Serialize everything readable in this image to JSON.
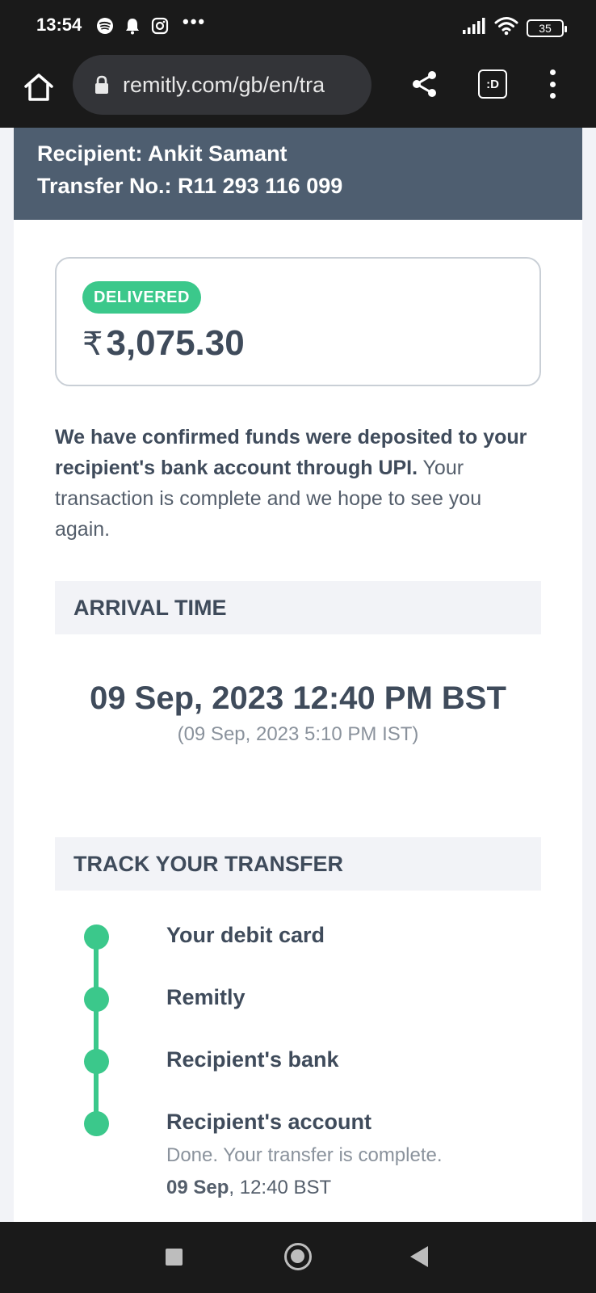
{
  "status_bar": {
    "time": "13:54",
    "more": "•••",
    "battery": "35",
    "icons_left": [
      "spotify-icon",
      "notification-bell-icon",
      "instagram-icon"
    ],
    "icons_right": [
      "signal-icon",
      "wifi-icon",
      "battery-icon"
    ]
  },
  "browser": {
    "url": "remitly.com/gb/en/tra",
    "tabs_label": ":D"
  },
  "banner": {
    "recipient": "Recipient: Ankit Samant",
    "transfer_no": "Transfer No.: R11 293 116 099"
  },
  "amount_card": {
    "status": "DELIVERED",
    "currency_symbol": "₹",
    "amount": "3,075.30"
  },
  "message": {
    "bold": "We have confirmed funds were deposited to your recipient's bank account through UPI.",
    "normal": " Your transaction is complete and we hope to see you again."
  },
  "arrival": {
    "header": "ARRIVAL TIME",
    "time_main": "09 Sep, 2023 12:40 PM BST",
    "time_local": "(09 Sep, 2023 5:10 PM IST)"
  },
  "track": {
    "header": "TRACK YOUR TRANSFER",
    "steps": [
      {
        "label": "Your debit card"
      },
      {
        "label": "Remitly"
      },
      {
        "label": "Recipient's bank"
      },
      {
        "label": "Recipient's account",
        "sub": "Done. Your transfer is complete.",
        "date_bold": "09 Sep",
        "date_rest": ", 12:40 BST"
      }
    ]
  },
  "colors": {
    "banner": "#4e5e70",
    "accent_green": "#3bc88b",
    "text_dark": "#3f4b5b"
  }
}
